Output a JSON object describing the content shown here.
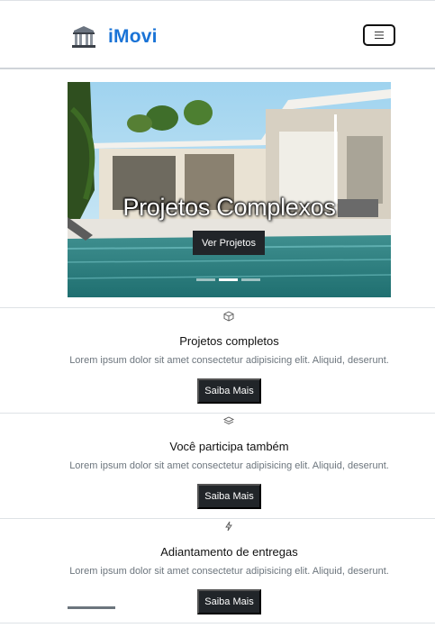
{
  "brand": {
    "name": "iMovi",
    "icon": "building-icon"
  },
  "navbar": {
    "toggler_icon": "hamburger-icon"
  },
  "carousel": {
    "caption": "Projetos Complexos",
    "button_label": "Ver Projetos",
    "indicators": 3,
    "active_indicator": 2
  },
  "features": [
    {
      "icon": "box-icon",
      "title": "Projetos completos",
      "text": "Lorem ipsum dolor sit amet consectetur adipisicing elit. Aliquid, deserunt.",
      "button_label": "Saiba Mais"
    },
    {
      "icon": "layers-icon",
      "title": "Você participa também",
      "text": "Lorem ipsum dolor sit amet consectetur adipisicing elit. Aliquid, deserunt.",
      "button_label": "Saiba Mais"
    },
    {
      "icon": "lightning-icon",
      "title": "Adiantamento de entregas",
      "text": "Lorem ipsum dolor sit amet consectetur adipisicing elit. Aliquid, deserunt.",
      "button_label": "Saiba Mais"
    }
  ],
  "colors": {
    "brand": "#1a73d6",
    "button": "#212529",
    "muted": "#6c757d"
  }
}
